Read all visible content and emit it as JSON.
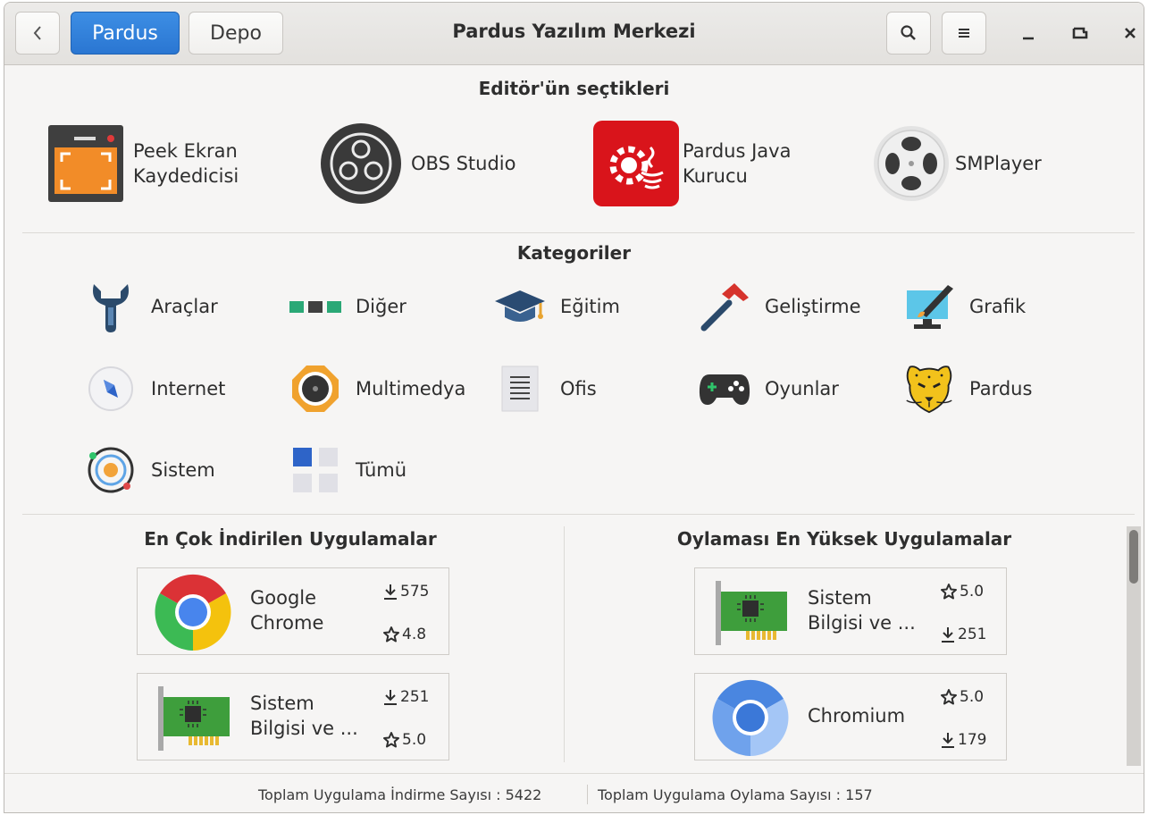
{
  "window": {
    "title": "Pardus Yazılım Merkezi"
  },
  "header": {
    "back_icon": "chevron-left-icon",
    "tabs": [
      {
        "label": "Pardus",
        "active": true
      },
      {
        "label": "Depo",
        "active": false
      }
    ],
    "search_icon": "search-icon",
    "menu_icon": "hamburger-menu-icon"
  },
  "editors": {
    "title": "Editör'ün seçtikleri",
    "items": [
      {
        "name": "Peek Ekran\nKaydedicisi",
        "icon": "peek-icon"
      },
      {
        "name": "OBS Studio",
        "icon": "obs-studio-icon"
      },
      {
        "name": "Pardus Java\nKurucu",
        "icon": "pardus-java-icon"
      },
      {
        "name": "SMPlayer",
        "icon": "smplayer-icon"
      }
    ]
  },
  "categories": {
    "title": "Kategoriler",
    "items": [
      {
        "label": "Araçlar",
        "icon": "tools-icon"
      },
      {
        "label": "Diğer",
        "icon": "other-icon"
      },
      {
        "label": "Eğitim",
        "icon": "graduation-cap-icon"
      },
      {
        "label": "Geliştirme",
        "icon": "hammer-icon"
      },
      {
        "label": "Grafik",
        "icon": "graphics-icon"
      },
      {
        "label": "Internet",
        "icon": "compass-icon"
      },
      {
        "label": "Multimedya",
        "icon": "multimedia-icon"
      },
      {
        "label": "Ofis",
        "icon": "document-icon"
      },
      {
        "label": "Oyunlar",
        "icon": "gamepad-icon"
      },
      {
        "label": "Pardus",
        "icon": "pardus-leopard-icon"
      },
      {
        "label": "Sistem",
        "icon": "system-icon"
      },
      {
        "label": "Tümü",
        "icon": "all-grid-icon"
      }
    ]
  },
  "most_downloaded": {
    "title": "En Çok İndirilen Uygulamalar",
    "items": [
      {
        "name": "Google\nChrome",
        "downloads": "575",
        "rating": "4.8",
        "icon": "google-chrome-icon"
      },
      {
        "name": "Sistem\nBilgisi ve ...",
        "downloads": "251",
        "rating": "5.0",
        "icon": "hardware-card-icon"
      }
    ]
  },
  "top_rated": {
    "title": "Oylaması En Yüksek Uygulamalar",
    "items": [
      {
        "name": "Sistem\nBilgisi ve ...",
        "rating": "5.0",
        "downloads": "251",
        "icon": "hardware-card-icon"
      },
      {
        "name": "Chromium",
        "rating": "5.0",
        "downloads": "179",
        "icon": "chromium-icon"
      }
    ]
  },
  "footer": {
    "downloads_label": "Toplam Uygulama İndirme Sayısı :",
    "downloads_value": "5422",
    "votes_label": "Toplam Uygulama Oylama Sayısı :",
    "votes_value": "157"
  }
}
